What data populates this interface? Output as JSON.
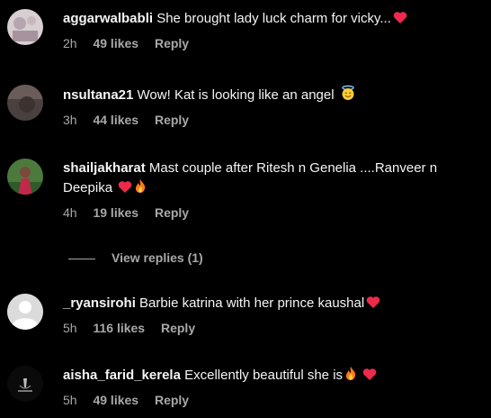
{
  "comments": [
    {
      "username": "aggarwalbabli",
      "text": "She brought lady luck charm for vicky...",
      "emoji": "heart-icon",
      "time": "2h",
      "likes": "49 likes",
      "reply": "Reply",
      "avatar": "avatar-photo"
    },
    {
      "username": "nsultana21",
      "text": "Wow! Kat is looking like an angel",
      "emoji": "smiling-face-with-halo-icon",
      "time": "3h",
      "likes": "44 likes",
      "reply": "Reply",
      "avatar": "avatar-photo"
    },
    {
      "username": "shailjakharat",
      "text": "Mast couple after Ritesh n Genelia ....Ranveer n",
      "text2": "Deepika",
      "emoji": "heart-fire-icons",
      "time": "4h",
      "likes": "19 likes",
      "reply": "Reply",
      "avatar": "avatar-photo",
      "view_replies": "View replies (1)"
    },
    {
      "username": "_ryansirohi",
      "text": "Barbie katrina with her prince kaushal",
      "emoji": "heart-icon",
      "time": "5h",
      "likes": "116 likes",
      "reply": "Reply",
      "avatar": "default-avatar"
    },
    {
      "username": "aisha_farid_kerela",
      "text": "Excellently beautiful she is",
      "emoji": "fire-heart-icons",
      "time": "5h",
      "likes": "49 likes",
      "reply": "Reply",
      "avatar": "avatar-photo"
    }
  ],
  "colors": {
    "background": "#000000",
    "text": "#f5f5f5",
    "muted": "#a8a8a8",
    "heart": "#ed2a4a"
  }
}
